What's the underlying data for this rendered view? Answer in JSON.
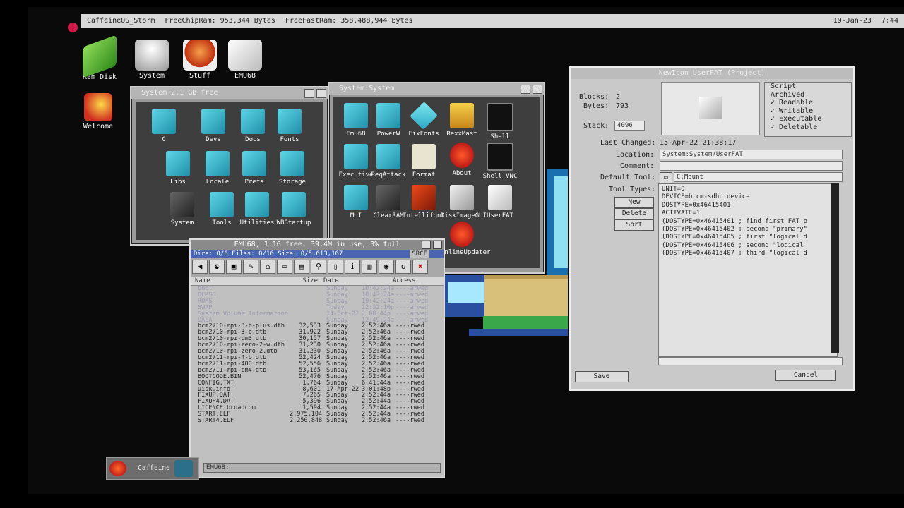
{
  "screen": {
    "title": "CaffeineOS_Storm",
    "free_chip_ram": "FreeChipRam: 953,344 Bytes",
    "free_fast_ram": "FreeFastRam: 358,488,944 Bytes",
    "date": "19-Jan-23",
    "time": "7:44"
  },
  "desktop_icons": [
    {
      "label": "Ram Disk",
      "icon": "ram-icon"
    },
    {
      "label": "System",
      "icon": "drive-icon"
    },
    {
      "label": "Stuff",
      "icon": "stuff-icon"
    },
    {
      "label": "EMU68",
      "icon": "emu68-icon"
    },
    {
      "label": "Welcome",
      "icon": "welcome-icon"
    }
  ],
  "system_window": {
    "title": "System   2.1 GB free",
    "icons": [
      "C",
      "Devs",
      "Docs",
      "Fonts",
      "Libs",
      "Locale",
      "Prefs",
      "Storage",
      "System",
      "Tools",
      "Utilities",
      "WBStartup"
    ]
  },
  "system_system_window": {
    "title": "System:System",
    "icons": [
      "Emu68",
      "PowerW",
      "FixFonts",
      "RexxMast",
      "Shell",
      "Executive",
      "ReqAttack",
      "Format",
      "About",
      "Shell_VNC",
      "MUI",
      "ClearRAM",
      "Intellifont",
      "DiskImageGUI",
      "UserFAT",
      "OnlineUpdater"
    ]
  },
  "file_manager": {
    "title": "EMU68,  1.1G free, 39.4M in use, 3% full",
    "status": "Dirs: 0/6 Files: 0/16 Size: 0/5,613,167",
    "srce": "SRCE",
    "columns": {
      "name": "Name",
      "size": "Size",
      "date": "Date",
      "access": "Access"
    },
    "dim_rows": [
      {
        "name": "boot",
        "date": "Sunday",
        "time": "10:42:24a",
        "access": "----arwed"
      },
      {
        "name": "OEMSS",
        "date": "Sunday",
        "time": "10:42:24a",
        "access": "----arwed"
      },
      {
        "name": "ROMS",
        "date": "Sunday",
        "time": "10:42:24a",
        "access": "----arwed"
      },
      {
        "name": "SWAP",
        "date": "Today",
        "time": "12:32:10p",
        "access": "----arwed"
      },
      {
        "name": "System Volume Information",
        "date": "14-Oct-22",
        "time": "2:08:44p",
        "access": "----arwed"
      },
      {
        "name": "UAEA",
        "date": "Sunday",
        "time": "12:49:24a",
        "access": "----arwed"
      }
    ],
    "rows": [
      {
        "name": "bcm2710-rpi-3-b-plus.dtb",
        "size": "32,533",
        "date": "Sunday",
        "time": "2:52:46a",
        "access": "----rwed"
      },
      {
        "name": "bcm2710-rpi-3-b.dtb",
        "size": "31,922",
        "date": "Sunday",
        "time": "2:52:46a",
        "access": "----rwed"
      },
      {
        "name": "bcm2710-rpi-cm3.dtb",
        "size": "30,157",
        "date": "Sunday",
        "time": "2:52:46a",
        "access": "----rwed"
      },
      {
        "name": "bcm2710-rpi-zero-2-w.dtb",
        "size": "31,230",
        "date": "Sunday",
        "time": "2:52:46a",
        "access": "----rwed"
      },
      {
        "name": "bcm2710-rpi-zero-2.dtb",
        "size": "31,230",
        "date": "Sunday",
        "time": "2:52:46a",
        "access": "----rwed"
      },
      {
        "name": "bcm2711-rpi-4-b.dtb",
        "size": "52,424",
        "date": "Sunday",
        "time": "2:52:46a",
        "access": "----rwed"
      },
      {
        "name": "bcm2711-rpi-400.dtb",
        "size": "52,556",
        "date": "Sunday",
        "time": "2:52:46a",
        "access": "----rwed"
      },
      {
        "name": "bcm2711-rpi-cm4.dtb",
        "size": "53,165",
        "date": "Sunday",
        "time": "2:52:46a",
        "access": "----rwed"
      },
      {
        "name": "BOOTCODE.BIN",
        "size": "52,476",
        "date": "Sunday",
        "time": "2:52:46a",
        "access": "----rwed"
      },
      {
        "name": "CONFIG.TXT",
        "size": "1,764",
        "date": "Sunday",
        "time": "6:41:44a",
        "access": "----rwed"
      },
      {
        "name": "Disk.info",
        "size": "8,601",
        "date": "17-Apr-22",
        "time": "3:01:48p",
        "access": "----rwed"
      },
      {
        "name": "FIXUP.DAT",
        "size": "7,265",
        "date": "Sunday",
        "time": "2:52:44a",
        "access": "----rwed"
      },
      {
        "name": "FIXUP4.DAT",
        "size": "5,396",
        "date": "Sunday",
        "time": "2:52:44a",
        "access": "----rwed"
      },
      {
        "name": "LICENCE.broadcom",
        "size": "1,594",
        "date": "Sunday",
        "time": "2:52:44a",
        "access": "----rwed"
      },
      {
        "name": "START.ELF",
        "size": "2,975,104",
        "date": "Sunday",
        "time": "2:52:44a",
        "access": "----rwed"
      },
      {
        "name": "START4.ELF",
        "size": "2,250,848",
        "date": "Sunday",
        "time": "2:52:46a",
        "access": "----rwed"
      }
    ],
    "path": "EMU68:"
  },
  "info_window": {
    "title": "NewIcon  UserFAT  (Project)",
    "blocks_label": "Blocks:",
    "blocks": "2",
    "bytes_label": "Bytes:",
    "bytes": "793",
    "stack_label": "Stack:",
    "stack": "4096",
    "last_changed_label": "Last Changed:",
    "last_changed": "15-Apr-22 21:38:17",
    "location_label": "Location:",
    "location": "System:System/UserFAT",
    "comment_label": "Comment:",
    "comment": "",
    "default_tool_label": "Default Tool:",
    "default_tool": "C:Mount",
    "tool_types_label": "Tool Types:",
    "new_button": "New",
    "delete_button": "Delete",
    "sort_button": "Sort",
    "flags": [
      "Script",
      "Archived",
      "✓ Readable",
      "✓ Writable",
      "✓ Executable",
      "✓ Deletable"
    ],
    "tool_types": "UNIT=0\nDEVICE=brcm-sdhc.device\nDOSTYPE=0x46415401\nACTIVATE=1\n(DOSTYPE=0x46415401 ; find first FAT p\n(DOSTYPE=0x46415402 ; second \"primary\"\n(DOSTYPE=0x46415405 ; first \"logical d\n(DOSTYPE=0x46415406 ; second \"logical\n(DOSTYPE=0x46415407 ; third \"logical d",
    "save_button": "Save",
    "cancel_button": "Cancel"
  },
  "taskbar": {
    "label": "Caffeine"
  }
}
